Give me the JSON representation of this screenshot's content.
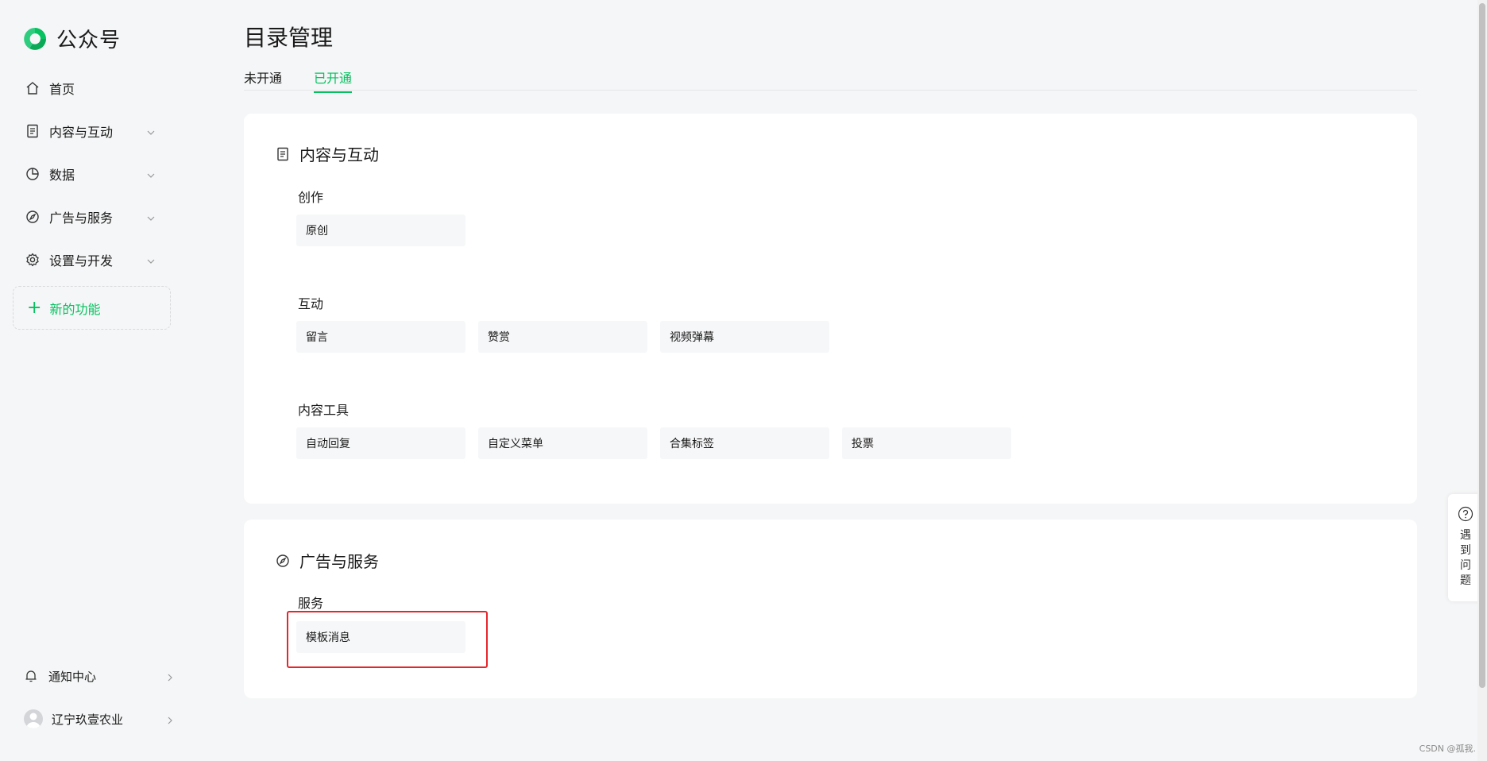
{
  "app": {
    "name": "公众号"
  },
  "sidebar": {
    "items": [
      {
        "label": "首页",
        "icon": "home-icon",
        "has_chevron": false
      },
      {
        "label": "内容与互动",
        "icon": "document-icon",
        "has_chevron": true
      },
      {
        "label": "数据",
        "icon": "pie-chart-icon",
        "has_chevron": true
      },
      {
        "label": "广告与服务",
        "icon": "compass-icon",
        "has_chevron": true
      },
      {
        "label": "设置与开发",
        "icon": "gear-icon",
        "has_chevron": true
      }
    ],
    "new_feature": {
      "label": "新的功能",
      "icon": "plus-icon"
    },
    "bottom": [
      {
        "label": "通知中心",
        "icon": "bell-icon"
      },
      {
        "label": "辽宁玖壹农业",
        "icon": "avatar-icon"
      }
    ]
  },
  "page": {
    "title": "目录管理",
    "tabs": [
      {
        "label": "未开通",
        "active": false
      },
      {
        "label": "已开通",
        "active": true
      }
    ]
  },
  "sections": [
    {
      "title": "内容与互动",
      "icon": "document-icon",
      "groups": [
        {
          "title": "创作",
          "features": [
            "原创"
          ]
        },
        {
          "title": "互动",
          "features": [
            "留言",
            "赞赏",
            "视频弹幕"
          ]
        },
        {
          "title": "内容工具",
          "features": [
            "自动回复",
            "自定义菜单",
            "合集标签",
            "投票"
          ]
        }
      ]
    },
    {
      "title": "广告与服务",
      "icon": "compass-icon",
      "groups": [
        {
          "title": "服务",
          "features": [
            "模板消息"
          ]
        }
      ]
    }
  ],
  "help": {
    "label": "遇到问题",
    "icon": "question-icon"
  },
  "watermark": "CSDN @孤我.",
  "colors": {
    "accent": "#07c160",
    "highlight": "#e6262d",
    "background": "#f5f6f7"
  }
}
